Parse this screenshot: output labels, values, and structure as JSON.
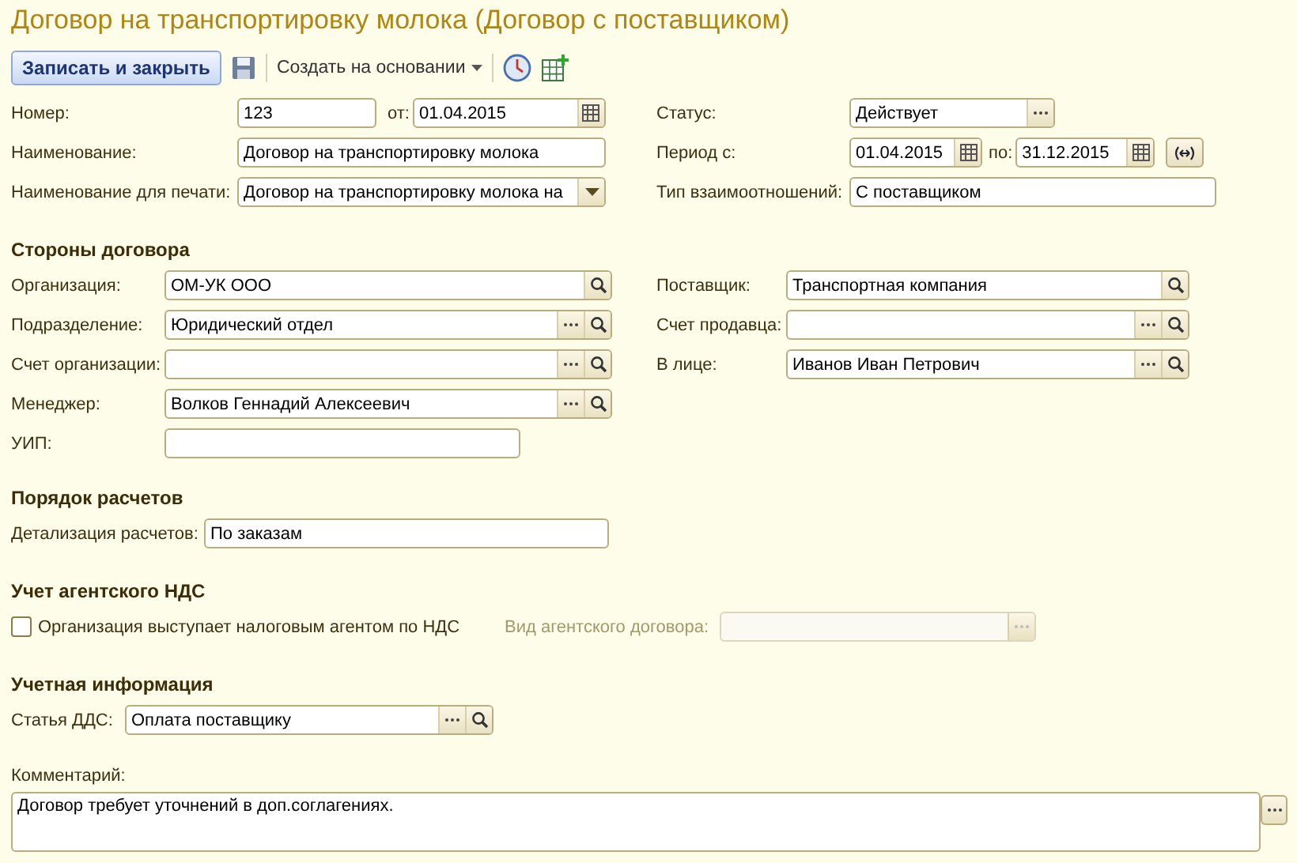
{
  "window": {
    "title": "Договор на транспортировку молока (Договор с поставщиком)"
  },
  "toolbar": {
    "save_close": "Записать и закрыть",
    "create_based": "Создать на основании"
  },
  "header": {
    "number": {
      "label": "Номер:",
      "value": "123"
    },
    "date": {
      "label": "от:",
      "value": "01.04.2015"
    },
    "name": {
      "label": "Наименование:",
      "value": "Договор на транспортировку молока"
    },
    "print_name": {
      "label": "Наименование для печати:",
      "value": "Договор на транспортировку молока на"
    },
    "status": {
      "label": "Статус:",
      "value": "Действует"
    },
    "period_from": {
      "label": "Период с:",
      "value": "01.04.2015"
    },
    "period_to": {
      "label": "по:",
      "value": "31.12.2015"
    },
    "relation": {
      "label": "Тип взаимоотношений:",
      "value": "С поставщиком"
    }
  },
  "parties": {
    "title": "Стороны договора",
    "left": [
      {
        "label": "Организация:",
        "value": "ОМ-УК ООО",
        "kind": "lookup"
      },
      {
        "label": "Подразделение:",
        "value": "Юридический отдел",
        "kind": "choice_lookup"
      },
      {
        "label": "Счет организации:",
        "kind": "choice_lookup"
      },
      {
        "label": "Менеджер:",
        "value": "Волков Геннадий Алексеевич",
        "kind": "choice_lookup"
      },
      {
        "label": "УИП:",
        "kind": "text"
      }
    ],
    "right": [
      {
        "label": "Поставщик:",
        "value": "Транспортная компания",
        "kind": "lookup"
      },
      {
        "label": "Счет продавца:",
        "kind": "choice_lookup"
      },
      {
        "label": "В лице:",
        "value": "Иванов Иван Петрович",
        "kind": "choice_lookup"
      }
    ]
  },
  "payments": {
    "title": "Порядок расчетов",
    "label": "Детализация расчетов:",
    "value": "По заказам"
  },
  "agent_vat": {
    "title": "Учет агентского НДС",
    "checkbox": {
      "label": "Организация выступает налоговым агентом по НДС",
      "checked": false
    },
    "contract_kind": {
      "label": "Вид агентского договора:",
      "disabled": true
    }
  },
  "accounting": {
    "title": "Учетная информация",
    "label": "Статья ДДС:",
    "value": "Оплата поставщику"
  },
  "comment": {
    "label": "Комментарий:",
    "value": "Договор требует уточнений в доп.соглагениях."
  }
}
